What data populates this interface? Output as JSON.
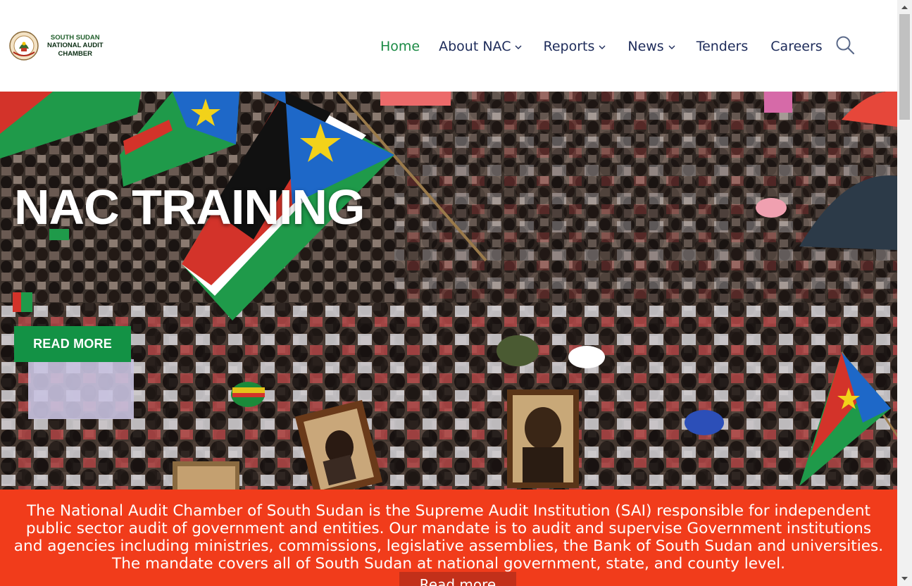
{
  "site": {
    "logo_alt": "South Sudan National Audit Chamber seal",
    "logo_lines": [
      "SOUTH SUDAN",
      "NATIONAL AUDIT",
      "CHAMBER"
    ]
  },
  "nav": {
    "items": [
      {
        "label": "Home",
        "active": true,
        "dropdown": false
      },
      {
        "label": "About NAC",
        "active": false,
        "dropdown": true
      },
      {
        "label": "Reports",
        "active": false,
        "dropdown": true
      },
      {
        "label": "News",
        "active": false,
        "dropdown": true
      },
      {
        "label": "Tenders",
        "active": false,
        "dropdown": false
      },
      {
        "label": "Careers",
        "active": false,
        "dropdown": false
      }
    ],
    "search_icon": "search-icon"
  },
  "hero": {
    "title": "NAC TRAINING",
    "button_label": "READ MORE"
  },
  "mandate": {
    "text": "The National Audit Chamber of South Sudan is the Supreme Audit Institution (SAI) responsible for independent public sector audit of government and entities. Our mandate is to audit and supervise Government institutions and agencies including ministries, commissions, legislative assemblies, the Bank of South Sudan and universities. The mandate covers all of South Sudan at national government, state, and county level.",
    "button_label": "Read more"
  },
  "colors": {
    "nav_text": "#1d2b5a",
    "nav_active": "#1a8a44",
    "hero_button": "#139245",
    "band_bg": "#f13c1b"
  }
}
